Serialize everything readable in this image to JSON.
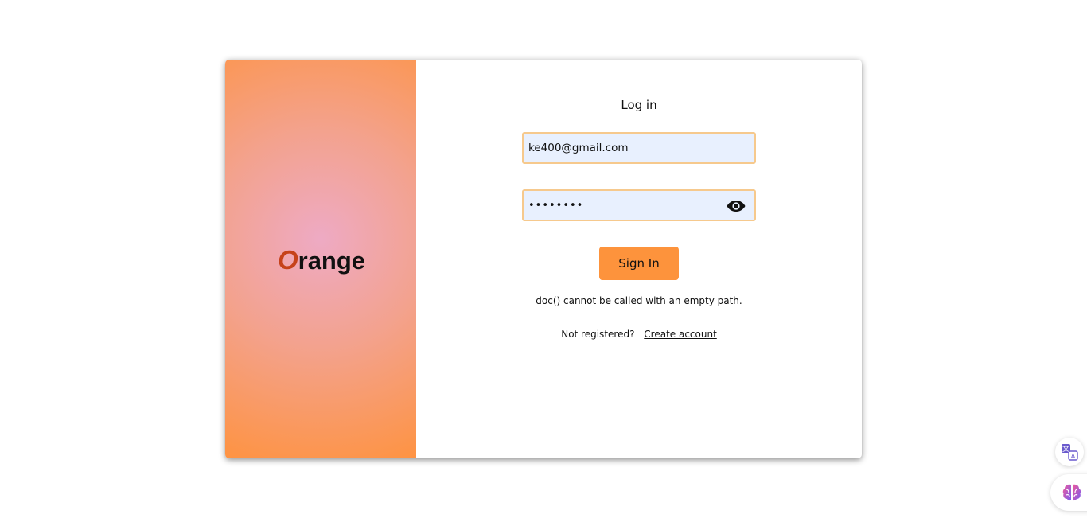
{
  "brand": {
    "logo_first_letter": "O",
    "logo_rest": "range"
  },
  "login": {
    "title": "Log in",
    "email_value": "ke400@gmail.com",
    "password_value": "passw0rd",
    "signin_label": "Sign In",
    "error_message": "doc() cannot be called with an empty path.",
    "register_prompt": "Not registered?",
    "register_link": "Create account"
  },
  "icons": {
    "password_toggle": "eye-icon",
    "translate": "translate-icon",
    "assistant": "brain-icon"
  },
  "colors": {
    "accent": "#fd933c",
    "field_border": "#f6c98d",
    "field_background": "#e8f0fe",
    "logo_letter": "#c6421a"
  }
}
